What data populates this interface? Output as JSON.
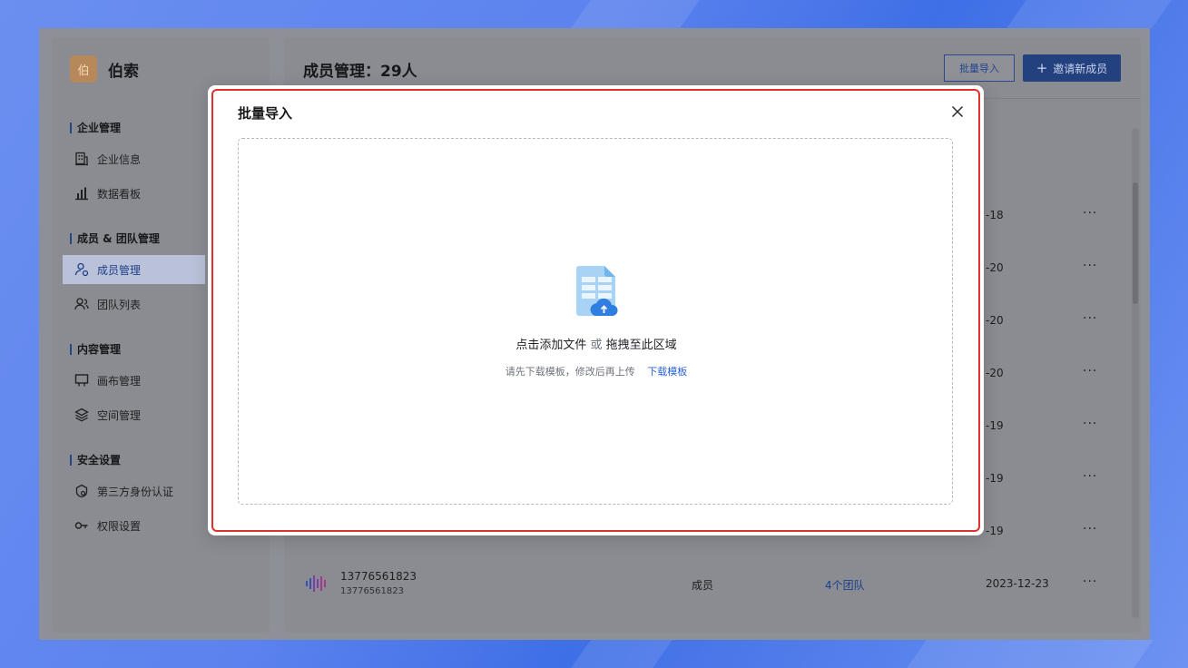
{
  "brand": {
    "logo_char": "伯",
    "name": "伯索"
  },
  "sidebar": {
    "sections": [
      {
        "title": "企业管理",
        "items": [
          {
            "label": "企业信息",
            "icon": "building-icon"
          },
          {
            "label": "数据看板",
            "icon": "bar-chart-icon"
          }
        ]
      },
      {
        "title": "成员 & 团队管理",
        "items": [
          {
            "label": "成员管理",
            "icon": "member-icon",
            "active": true
          },
          {
            "label": "团队列表",
            "icon": "team-icon"
          }
        ]
      },
      {
        "title": "内容管理",
        "items": [
          {
            "label": "画布管理",
            "icon": "canvas-icon"
          },
          {
            "label": "空间管理",
            "icon": "layers-icon"
          }
        ]
      },
      {
        "title": "安全设置",
        "items": [
          {
            "label": "第三方身份认证",
            "icon": "shield-icon"
          },
          {
            "label": "权限设置",
            "icon": "key-icon"
          }
        ]
      }
    ]
  },
  "main": {
    "title": "成员管理：29人",
    "import_label": "批量导入",
    "invite_label": "邀请新成员",
    "invite_icon": "+",
    "rows": [
      {
        "date": "-18",
        "more": "···"
      },
      {
        "date": "-20",
        "more": "···"
      },
      {
        "date": "-20",
        "more": "···"
      },
      {
        "date": "-20",
        "more": "···"
      },
      {
        "date": "-19",
        "more": "···"
      },
      {
        "date": "-19",
        "more": "···"
      },
      {
        "date": "-19",
        "more": "···"
      }
    ],
    "last_row": {
      "name": "13776561823",
      "sub": "13776561823",
      "role": "成员",
      "teams": "4个团队",
      "date": "2023-12-23",
      "more": "···"
    }
  },
  "modal": {
    "title": "批量导入",
    "close_icon": "close-icon",
    "drop_main": "点击添加文件",
    "drop_or": "或",
    "drop_alt": "拖拽至此区域",
    "hint": "请先下载模板，修改后再上传",
    "download_link": "下载模板",
    "highlight_color": "#e0322b",
    "accent_color": "#2d64d8"
  }
}
